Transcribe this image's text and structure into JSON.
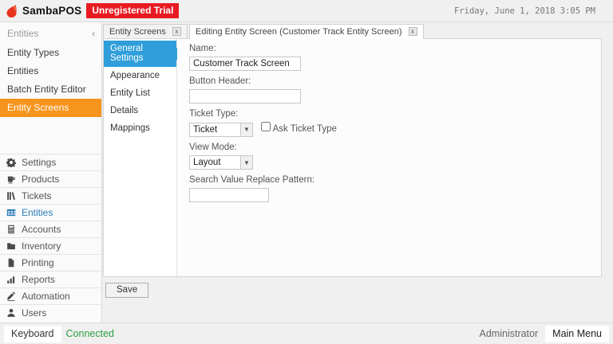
{
  "window": {
    "app_title": "SambaPOS",
    "trial_badge": "Unregistered Trial",
    "datetime": "Friday, June 1, 2018 3:05 PM"
  },
  "colors": {
    "window_bg": "#f0f0f0",
    "accent_orange": "#f7941d",
    "accent_blue": "#2f9edb",
    "badge_red": "#e81b22",
    "connected_green": "#2e9e44",
    "entities_blue": "#2b7cb8"
  },
  "sidebar": {
    "section_header": "Entities",
    "collapse_icon": "‹",
    "section_items": [
      {
        "label": "Entity Types",
        "selected": false
      },
      {
        "label": "Entities",
        "selected": false
      },
      {
        "label": "Batch Entity Editor",
        "selected": false
      },
      {
        "label": "Entity Screens",
        "selected": true
      }
    ],
    "menu": [
      {
        "label": "Settings",
        "icon": "gear-icon",
        "active": false
      },
      {
        "label": "Products",
        "icon": "cup-icon",
        "active": false
      },
      {
        "label": "Tickets",
        "icon": "books-icon",
        "active": false
      },
      {
        "label": "Entities",
        "icon": "table-icon",
        "active": true
      },
      {
        "label": "Accounts",
        "icon": "calculator-icon",
        "active": false
      },
      {
        "label": "Inventory",
        "icon": "folder-icon",
        "active": false
      },
      {
        "label": "Printing",
        "icon": "page-icon",
        "active": false
      },
      {
        "label": "Reports",
        "icon": "bar-chart-icon",
        "active": false
      },
      {
        "label": "Automation",
        "icon": "pencil-icon",
        "active": false
      },
      {
        "label": "Users",
        "icon": "person-icon",
        "active": false
      }
    ]
  },
  "tabs": [
    {
      "label": "Entity Screens",
      "active": false
    },
    {
      "label": "Editing Entity Screen (Customer Track Entity Screen)",
      "active": true
    }
  ],
  "editor": {
    "nav": [
      {
        "label": "General Settings",
        "selected": true
      },
      {
        "label": "Appearance",
        "selected": false
      },
      {
        "label": "Entity List",
        "selected": false
      },
      {
        "label": "Details",
        "selected": false
      },
      {
        "label": "Mappings",
        "selected": false
      }
    ],
    "form": {
      "name_label": "Name:",
      "name_value": "Customer Track Screen",
      "button_header_label": "Button Header:",
      "button_header_value": "",
      "ticket_type_label": "Ticket Type:",
      "ticket_type_value": "Ticket",
      "ask_ticket_type_label": "Ask Ticket Type",
      "ask_ticket_type_checked": false,
      "view_mode_label": "View Mode:",
      "view_mode_value": "Layout",
      "search_pattern_label": "Search Value Replace Pattern:",
      "search_pattern_value": ""
    },
    "save_label": "Save"
  },
  "statusbar": {
    "keyboard_label": "Keyboard",
    "connection_status": "Connected",
    "user": "Administrator",
    "main_menu_label": "Main Menu"
  }
}
